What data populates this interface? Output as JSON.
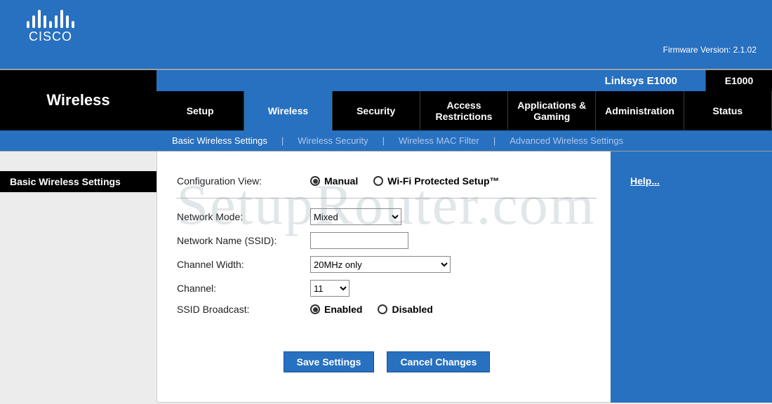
{
  "brand": "CISCO",
  "firmware_label": "Firmware Version: 2.1.02",
  "product_name": "Linksys E1000",
  "model_short": "E1000",
  "page_title": "Wireless",
  "tabs": {
    "setup": "Setup",
    "wireless": "Wireless",
    "security": "Security",
    "access": "Access Restrictions",
    "apps": "Applications & Gaming",
    "admin": "Administration",
    "status": "Status"
  },
  "subnav": {
    "basic": "Basic Wireless Settings",
    "security": "Wireless Security",
    "mac": "Wireless MAC Filter",
    "advanced": "Advanced Wireless Settings"
  },
  "section_title": "Basic Wireless Settings",
  "form": {
    "config_view_label": "Configuration View:",
    "manual": "Manual",
    "wps": "Wi-Fi Protected Setup™",
    "config_view_selected": "manual",
    "network_mode_label": "Network Mode:",
    "network_mode_value": "Mixed",
    "ssid_label": "Network Name (SSID):",
    "ssid_value": "",
    "channel_width_label": "Channel Width:",
    "channel_width_value": "20MHz only",
    "channel_label": "Channel:",
    "channel_value": "11",
    "broadcast_label": "SSID Broadcast:",
    "enabled": "Enabled",
    "disabled": "Disabled",
    "broadcast_selected": "enabled"
  },
  "buttons": {
    "save": "Save Settings",
    "cancel": "Cancel Changes"
  },
  "help": "Help...",
  "watermark": "SetupRouter.com"
}
